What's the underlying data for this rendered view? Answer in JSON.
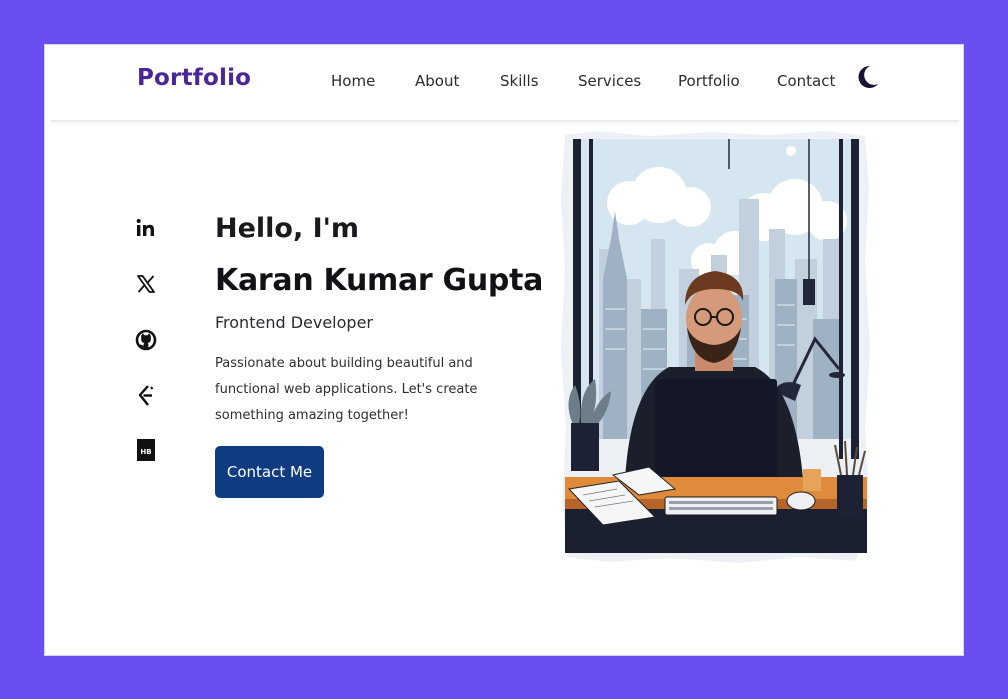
{
  "nav": {
    "brand": "Portfolio",
    "links": [
      "Home",
      "About",
      "Skills",
      "Services",
      "Portfolio",
      "Contact"
    ],
    "theme_icon": "moon-icon"
  },
  "social": [
    {
      "name": "linkedin",
      "icon": "linkedin-icon"
    },
    {
      "name": "x",
      "icon": "x-icon"
    },
    {
      "name": "github",
      "icon": "github-icon"
    },
    {
      "name": "codechef",
      "icon": "codechef-icon"
    },
    {
      "name": "hashnode",
      "icon": "hashnode-icon"
    }
  ],
  "hero": {
    "greeting": "Hello, I'm",
    "name": "Karan Kumar Gupta",
    "role": "Frontend Developer",
    "bio": "Passionate about building beautiful and functional web applications. Let's create something amazing together!",
    "cta_label": "Contact Me",
    "illustration": "developer-at-desk-illustration"
  },
  "colors": {
    "background": "#6a4ef0",
    "brand": "#4a2696",
    "cta": "#0f3b80",
    "text": "#1a1a1e"
  }
}
